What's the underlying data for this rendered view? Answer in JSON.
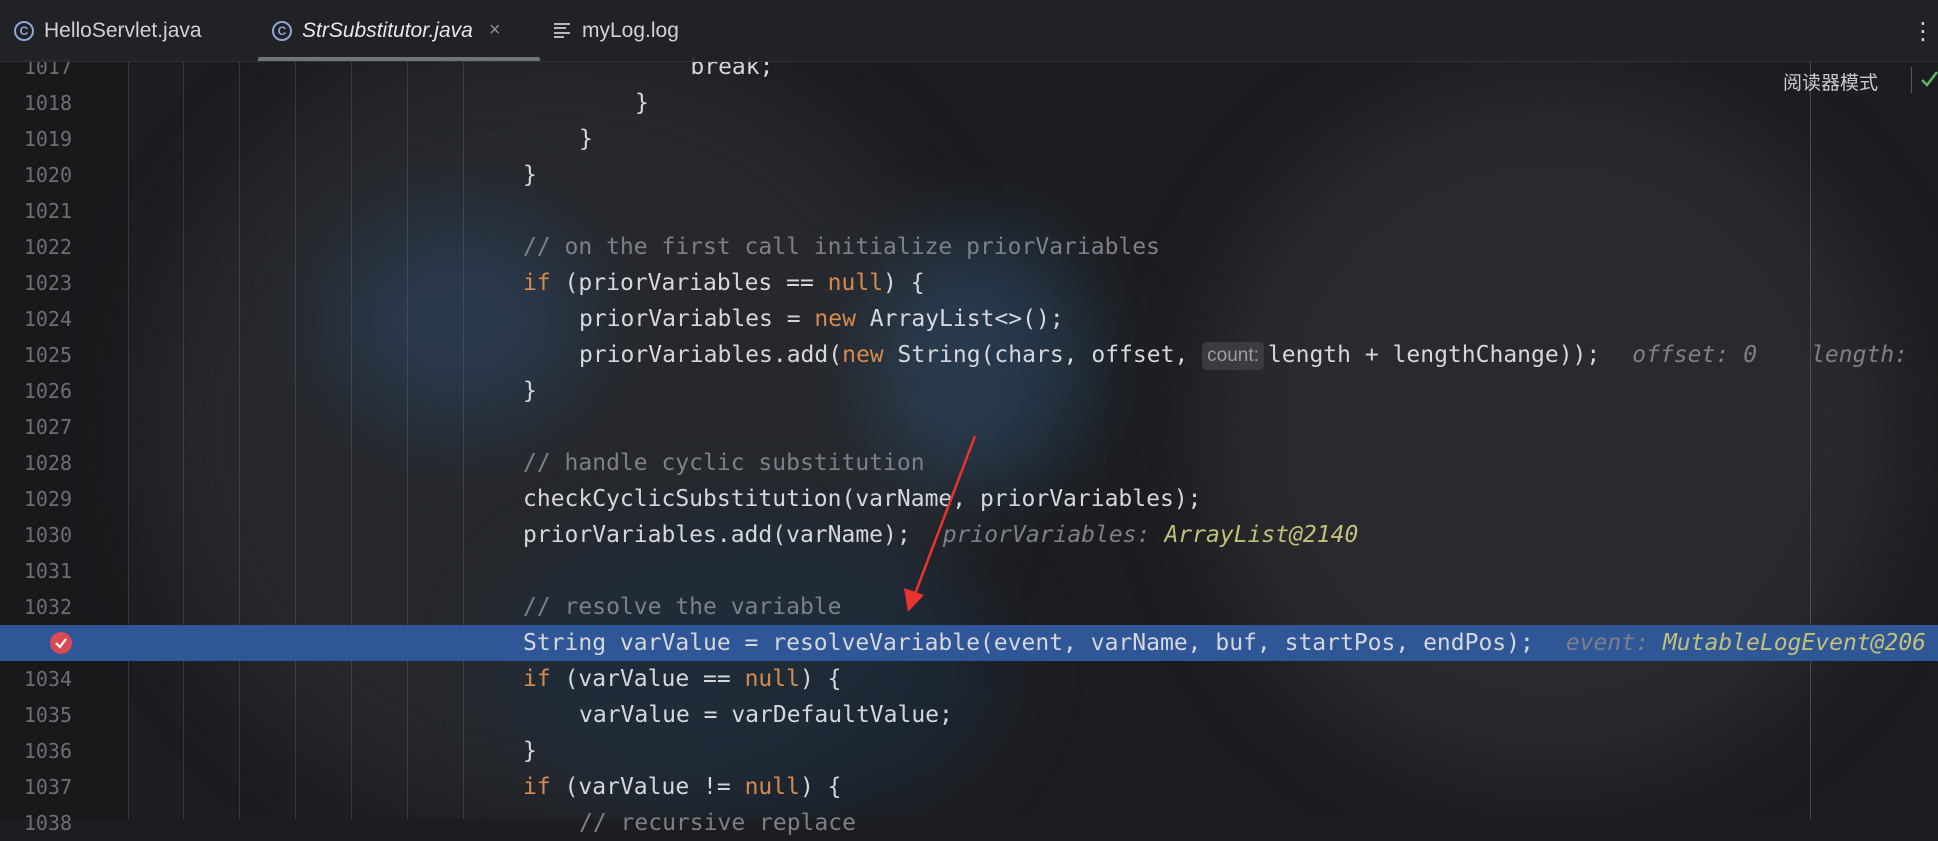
{
  "tabs": [
    {
      "label": "HelloServlet.java",
      "icon": "java-class-icon",
      "active": false
    },
    {
      "label": "StrSubstitutor.java",
      "icon": "java-class-icon",
      "active": true,
      "close": "×"
    },
    {
      "label": "myLog.log",
      "icon": "log-file-icon",
      "active": false
    }
  ],
  "more_menu": "⋮",
  "reader_mode": "阅读器模式",
  "editor": {
    "lines": [
      {
        "num": "1017",
        "indent": 3,
        "code": "    break;"
      },
      {
        "num": "1018",
        "indent": 2,
        "code": "}"
      },
      {
        "num": "1019",
        "indent": 1,
        "code": "}"
      },
      {
        "num": "1020",
        "indent": 0,
        "code": "}"
      },
      {
        "num": "1021",
        "indent": 0,
        "code": ""
      },
      {
        "num": "1022",
        "comment": "// on the first call initialize priorVariables"
      },
      {
        "num": "1023",
        "kw": "if",
        "code": " (priorVariables == ",
        "kw2": "null",
        "code2": ") {"
      },
      {
        "num": "1024",
        "code_a": "priorVariables = ",
        "kw": "new",
        "code_b": " ArrayList<>();"
      },
      {
        "num": "1025",
        "code_a": "priorVariables.add(",
        "kw": "new",
        "code_b": " String(chars, offset, ",
        "inlay": "count:",
        "code_c": "length + lengthChange));",
        "hint1_label": "offset:",
        "hint1_value": "0",
        "hint2_label": "length:"
      },
      {
        "num": "1026",
        "code": "}"
      },
      {
        "num": "1027",
        "code": ""
      },
      {
        "num": "1028",
        "comment": "// handle cyclic substitution"
      },
      {
        "num": "1029",
        "code": "checkCyclicSubstitution(varName, priorVariables);"
      },
      {
        "num": "1030",
        "code": "priorVariables.add(varName);",
        "hint_label": "priorVariables:",
        "hint_value": "ArrayList@2140"
      },
      {
        "num": "1031",
        "code": ""
      },
      {
        "num": "1032",
        "comment": "// resolve the variable"
      },
      {
        "num": "1033",
        "code": "String varValue = resolveVariable(event, varName, buf, startPos, endPos);",
        "hint_label": "event:",
        "hint_value": "MutableLogEvent@206"
      },
      {
        "num": "1034",
        "kw": "if",
        "code": " (varValue == ",
        "kw2": "null",
        "code2": ") {"
      },
      {
        "num": "1035",
        "code": "varValue = varDefaultValue;"
      },
      {
        "num": "1036",
        "code": "}"
      },
      {
        "num": "1037",
        "kw": "if",
        "code": " (varValue != ",
        "kw2": "null",
        "code2": ") {"
      },
      {
        "num": "1038",
        "comment": "// recursive replace"
      }
    ]
  },
  "colors": {
    "current_line": "#2f5696",
    "keyword": "#d58a4f",
    "comment": "#7d8088",
    "hint_value": "#c3c07a",
    "breakpoint": "#d94a55",
    "arrow": "#e8332f"
  }
}
